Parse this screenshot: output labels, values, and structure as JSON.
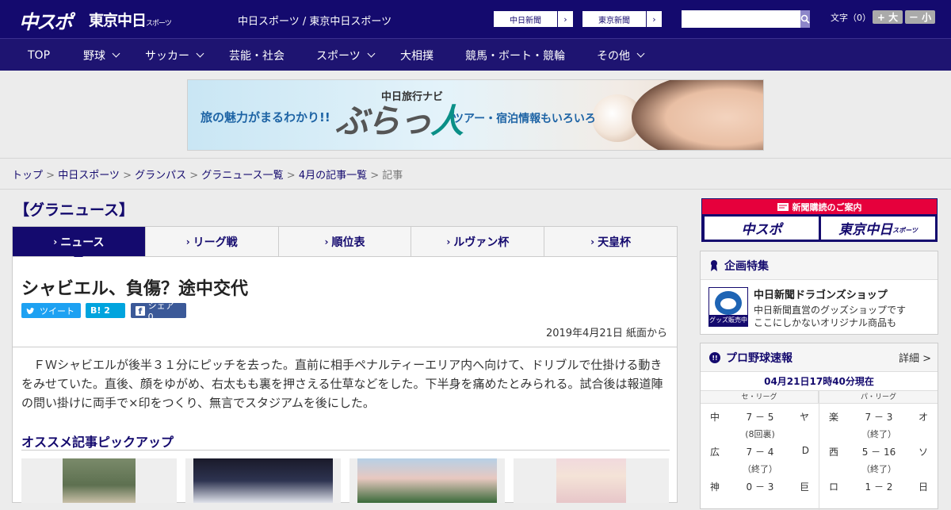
{
  "header": {
    "logo_main": "中スポ",
    "logo_sub": "東京中日",
    "logo_sub_small": "スポーツ",
    "tagline": "中日スポーツ / 東京中日スポーツ",
    "btn_chunichi": "中日新聞",
    "btn_tokyo": "東京新聞",
    "search_placeholder": "",
    "font_label": "文字（0）",
    "font_large": "+ 大",
    "font_small": "－ 小"
  },
  "nav": [
    "TOP",
    "野球",
    "サッカー",
    "芸能・社会",
    "スポーツ",
    "大相撲",
    "競馬・ボート・競輪",
    "その他"
  ],
  "ad": {
    "left": "旅の魅力がまるわかり!!",
    "brand_top": "中日旅行ナビ",
    "brand_a": "ぶらっ",
    "brand_b": "人",
    "right": "ツアー・宿泊情報もいろいろ"
  },
  "breadcrumb": [
    "トップ",
    "中日スポーツ",
    "グランパス",
    "グラニュース一覧",
    "4月の記事一覧",
    "記事"
  ],
  "section_title": "【グラニュース】",
  "tabs": [
    "ニュース",
    "リーグ戦",
    "順位表",
    "ルヴァン杯",
    "天皇杯"
  ],
  "article": {
    "title": "シャビエル、負傷？途中交代",
    "tweet": "ツイート",
    "hatena": "B! 2",
    "share": "シェア 0",
    "date": "2019年4月21日 紙面から",
    "body": "　ＦＷシャビエルが後半３１分にピッチを去った。直前に相手ペナルティーエリア内へ向けて、ドリブルで仕掛ける動きをみせていた。直後、顔をゆがめ、右太もも裏を押さえる仕草などをした。下半身を痛めたとみられる。試合後は報道陣の問い掛けに両手で×印をつくり、無言でスタジアムを後にした。",
    "pickup": "オススメ記事ピックアップ"
  },
  "sidebar": {
    "subscribe": "新聞購読のご案内",
    "sub_left": "中スポ",
    "sub_right": "東京中日",
    "sub_right_small": "スポーツ",
    "feature_title": "企画特集",
    "shop_label": "グッズ販売中",
    "shop_title": "中日新聞ドラゴンズショップ",
    "shop_desc1": "中日新聞直営のグッズショップです",
    "shop_desc2": "ここにしかないオリジナル商品も",
    "baseball_title": "プロ野球速報",
    "detail": "詳細 >",
    "update": "04月21日17時40分現在",
    "central": "セ・リーグ",
    "pacific": "パ・リーグ",
    "games_c": [
      {
        "home": "中",
        "score": "7 － 5",
        "away": "ヤ",
        "status": "(8回裏)"
      },
      {
        "home": "広",
        "score": "7 － 4",
        "away": "D",
        "status": "（終了）"
      },
      {
        "home": "神",
        "score": "0 － 3",
        "away": "巨",
        "status": ""
      }
    ],
    "games_p": [
      {
        "home": "楽",
        "score": "7 － 3",
        "away": "オ",
        "status": "（終了）"
      },
      {
        "home": "西",
        "score": "5 － 16",
        "away": "ソ",
        "status": "（終了）"
      },
      {
        "home": "ロ",
        "score": "1 － 2",
        "away": "日",
        "status": ""
      }
    ]
  },
  "colors": {
    "brand": "#140a6e",
    "accent_red": "#e6003c",
    "twitter": "#1da1f2",
    "facebook": "#3b5998"
  }
}
